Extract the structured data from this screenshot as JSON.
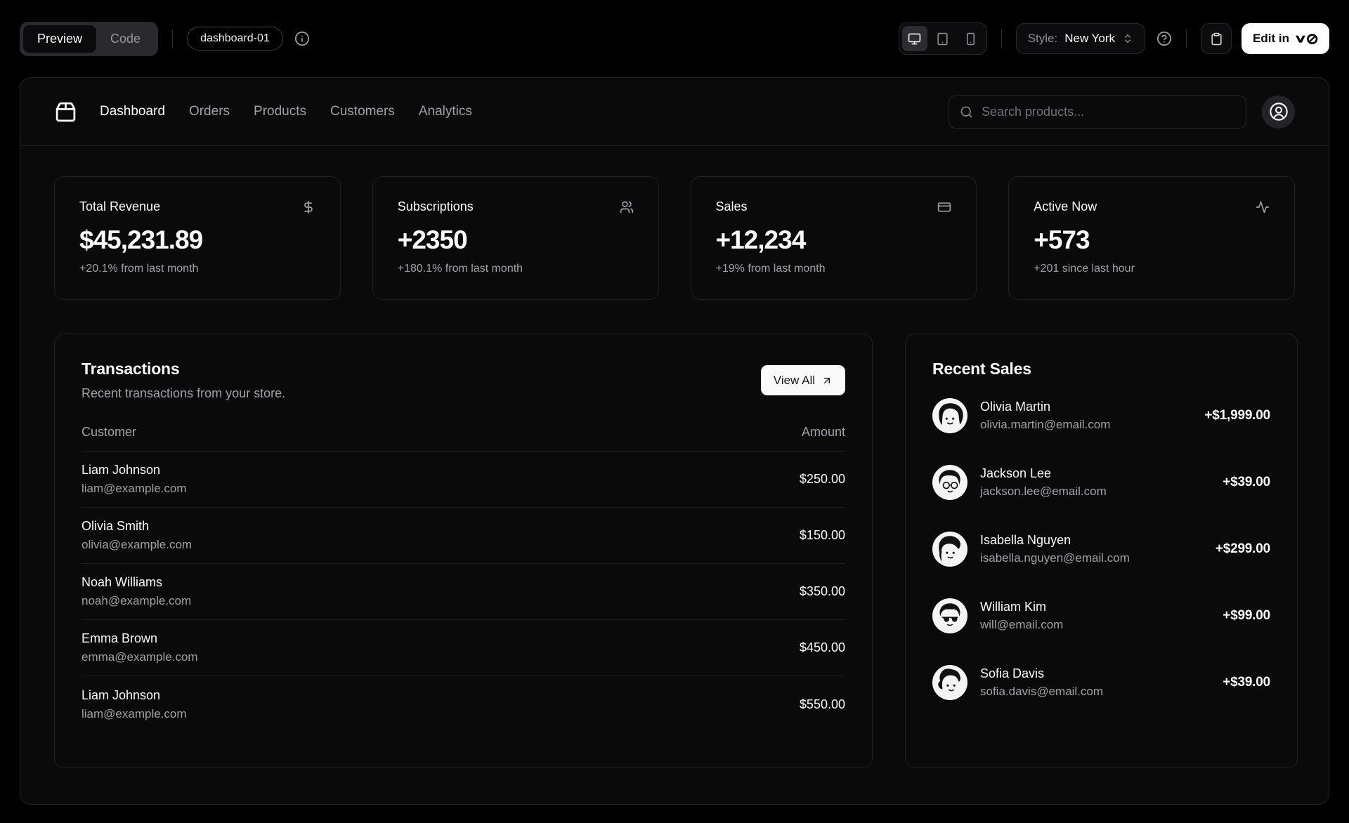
{
  "toolbar": {
    "preview_label": "Preview",
    "code_label": "Code",
    "block_badge": "dashboard-01",
    "style_label": "Style:",
    "style_value": "New York",
    "edit_label": "Edit in",
    "icons": {
      "info": "info-circle-icon",
      "devices": [
        "monitor-icon",
        "tablet-icon",
        "smartphone-icon"
      ],
      "help": "help-circle-icon",
      "copy": "clipboard-icon",
      "logo": "v0-logo"
    }
  },
  "nav": {
    "logo_icon": "package-icon",
    "items": [
      "Dashboard",
      "Orders",
      "Products",
      "Customers",
      "Analytics"
    ],
    "active_item": "Dashboard",
    "search_placeholder": "Search products...",
    "search_icon": "search-icon",
    "account_icon": "user-circle-icon"
  },
  "stats": [
    {
      "title": "Total Revenue",
      "icon": "dollar-sign-icon",
      "value": "$45,231.89",
      "change": "+20.1% from last month"
    },
    {
      "title": "Subscriptions",
      "icon": "users-icon",
      "value": "+2350",
      "change": "+180.1% from last month"
    },
    {
      "title": "Sales",
      "icon": "credit-card-icon",
      "value": "+12,234",
      "change": "+19% from last month"
    },
    {
      "title": "Active Now",
      "icon": "activity-icon",
      "value": "+573",
      "change": "+201 since last hour"
    }
  ],
  "transactions": {
    "title": "Transactions",
    "description": "Recent transactions from your store.",
    "view_all_label": "View All",
    "view_all_icon": "arrow-up-right-icon",
    "columns": [
      "Customer",
      "Amount"
    ],
    "rows": [
      {
        "name": "Liam Johnson",
        "email": "liam@example.com",
        "amount": "$250.00"
      },
      {
        "name": "Olivia Smith",
        "email": "olivia@example.com",
        "amount": "$150.00"
      },
      {
        "name": "Noah Williams",
        "email": "noah@example.com",
        "amount": "$350.00"
      },
      {
        "name": "Emma Brown",
        "email": "emma@example.com",
        "amount": "$450.00"
      },
      {
        "name": "Liam Johnson",
        "email": "liam@example.com",
        "amount": "$550.00"
      }
    ]
  },
  "recent_sales": {
    "title": "Recent Sales",
    "items": [
      {
        "name": "Olivia Martin",
        "email": "olivia.martin@email.com",
        "amount": "+$1,999.00"
      },
      {
        "name": "Jackson Lee",
        "email": "jackson.lee@email.com",
        "amount": "+$39.00"
      },
      {
        "name": "Isabella Nguyen",
        "email": "isabella.nguyen@email.com",
        "amount": "+$299.00"
      },
      {
        "name": "William Kim",
        "email": "will@email.com",
        "amount": "+$99.00"
      },
      {
        "name": "Sofia Davis",
        "email": "sofia.davis@email.com",
        "amount": "+$39.00"
      }
    ]
  },
  "colors": {
    "background": "#000000",
    "panel": "#0a0a0b",
    "border": "#202026",
    "text": "#fafafa",
    "muted_text": "#a1a1aa",
    "primary_button": "#fafafa"
  }
}
